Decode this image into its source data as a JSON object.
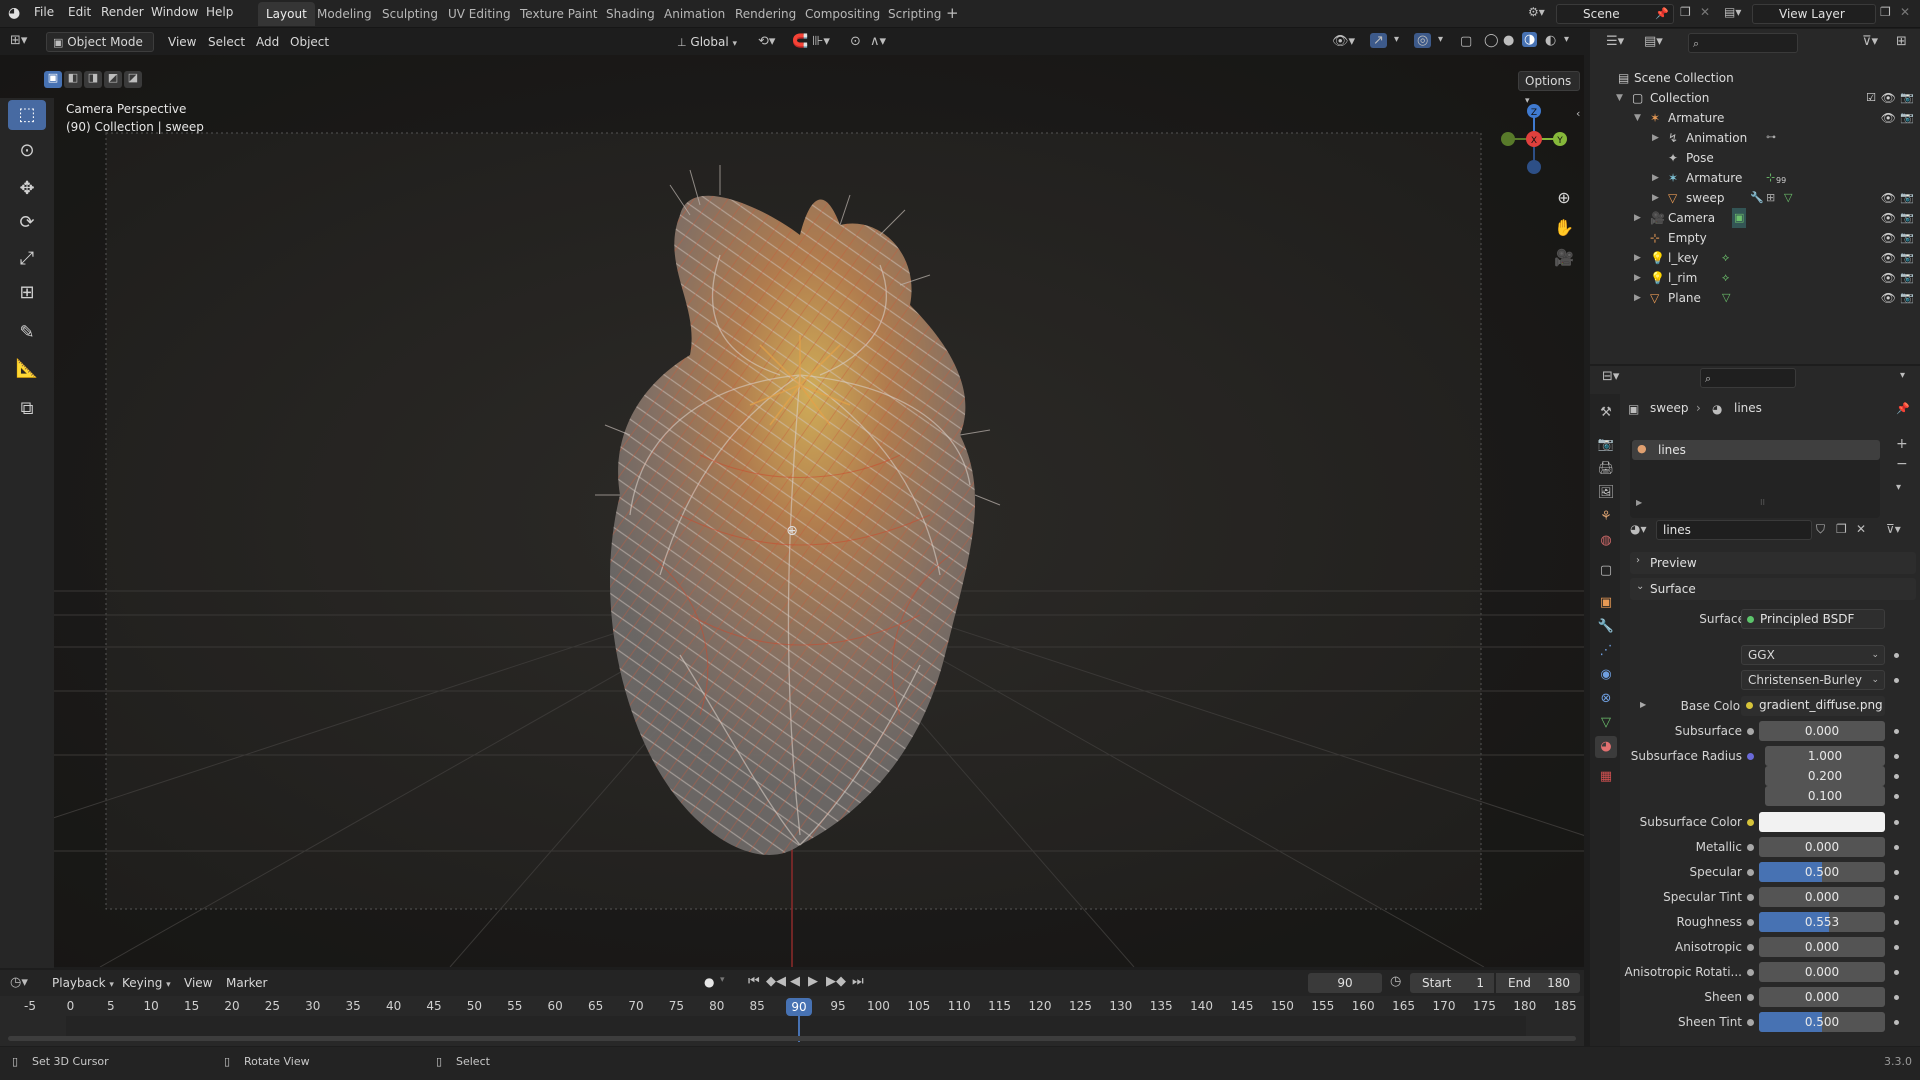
{
  "menu": {
    "file": "File",
    "edit": "Edit",
    "render": "Render",
    "window": "Window",
    "help": "Help"
  },
  "workspaces": [
    "Layout",
    "Modeling",
    "Sculpting",
    "UV Editing",
    "Texture Paint",
    "Shading",
    "Animation",
    "Rendering",
    "Compositing",
    "Scripting"
  ],
  "active_workspace": "Layout",
  "scene_field": "Scene",
  "view_layer_field": "View Layer",
  "viewport_header": {
    "mode": "Object Mode",
    "view": "View",
    "select": "Select",
    "add": "Add",
    "object": "Object",
    "orientation": "Global",
    "options": "Options"
  },
  "viewport": {
    "line1": "Camera Perspective",
    "line2": "(90) Collection | sweep"
  },
  "gizmo": {
    "x": "X",
    "y": "Y",
    "z": "Z"
  },
  "outliner": {
    "scene_collection": "Scene Collection",
    "rows": [
      {
        "label": "Collection",
        "icon": "collection-icon"
      },
      {
        "label": "Armature",
        "icon": "armature-icon"
      },
      {
        "label": "Animation",
        "icon": "animation-icon"
      },
      {
        "label": "Pose",
        "icon": "pose-icon"
      },
      {
        "label": "Armature",
        "icon": "armature-data-icon",
        "badge": "99"
      },
      {
        "label": "sweep",
        "icon": "mesh-icon"
      },
      {
        "label": "Camera",
        "icon": "camera-icon"
      },
      {
        "label": "Empty",
        "icon": "empty-icon"
      },
      {
        "label": "l_key",
        "icon": "light-icon"
      },
      {
        "label": "l_rim",
        "icon": "light-icon"
      },
      {
        "label": "Plane",
        "icon": "mesh-icon"
      }
    ]
  },
  "properties": {
    "breadcrumb_object": "sweep",
    "breadcrumb_material": "lines",
    "slot_name": "lines",
    "material_name": "lines",
    "preview": "Preview",
    "surface_panel": "Surface",
    "surface_label": "Surface",
    "surface_shader": "Principled BSDF",
    "distribution": "GGX",
    "subsurface_method": "Christensen-Burley",
    "base_color_label": "Base Color",
    "base_color_value": "gradient_diffuse.png",
    "fields": [
      {
        "label": "Subsurface",
        "value": "0.000",
        "fill": 0
      },
      {
        "label": "Subsurface Radius",
        "value": "1.000",
        "fill": 0
      },
      {
        "label": "",
        "value": "0.200",
        "fill": 0
      },
      {
        "label": "",
        "value": "0.100",
        "fill": 0
      },
      {
        "label": "Subsurface Color",
        "value": "",
        "fill": 0
      },
      {
        "label": "Metallic",
        "value": "0.000",
        "fill": 0
      },
      {
        "label": "Specular",
        "value": "0.500",
        "fill": 0.5
      },
      {
        "label": "Specular Tint",
        "value": "0.000",
        "fill": 0
      },
      {
        "label": "Roughness",
        "value": "0.553",
        "fill": 0.553
      },
      {
        "label": "Anisotropic",
        "value": "0.000",
        "fill": 0
      },
      {
        "label": "Anisotropic Rotati...",
        "value": "0.000",
        "fill": 0
      },
      {
        "label": "Sheen",
        "value": "0.000",
        "fill": 0
      },
      {
        "label": "Sheen Tint",
        "value": "0.500",
        "fill": 0.5
      }
    ]
  },
  "timeline": {
    "playback": "Playback",
    "keying": "Keying",
    "view": "View",
    "marker": "Marker",
    "current_frame": "90",
    "start_label": "Start",
    "start": "1",
    "end_label": "End",
    "end": "180",
    "ticks": [
      "-5",
      "0",
      "5",
      "10",
      "15",
      "20",
      "25",
      "30",
      "35",
      "40",
      "45",
      "50",
      "55",
      "60",
      "65",
      "70",
      "75",
      "80",
      "85",
      "90",
      "95",
      "100",
      "105",
      "110",
      "115",
      "120",
      "125",
      "130",
      "135",
      "140",
      "145",
      "150",
      "155",
      "160",
      "165",
      "170",
      "175",
      "180",
      "185"
    ]
  },
  "status": {
    "left": "Set 3D Cursor",
    "middle": "Rotate View",
    "right": "Select",
    "version": "3.3.0"
  },
  "colors": {
    "accent": "#4772b3",
    "active_tool": "#476aa2",
    "axis_x": "#e0403d",
    "axis_y": "#86b83a",
    "axis_z": "#3f7ad0",
    "frame": "#4772b3"
  }
}
